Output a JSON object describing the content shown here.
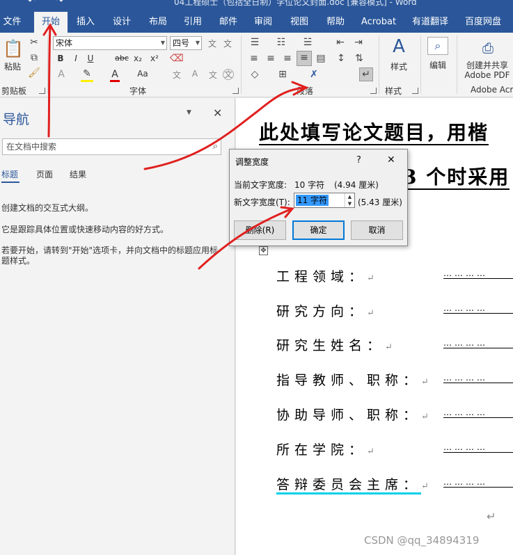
{
  "window": {
    "title": "04工程硕士（包括全日制）学位论文封面.doc [兼容模式] - Word"
  },
  "tabs": [
    "文件",
    "开始",
    "插入",
    "设计",
    "布局",
    "引用",
    "邮件",
    "审阅",
    "视图",
    "帮助",
    "Acrobat",
    "有道翻译",
    "百度网盘"
  ],
  "ribbon": {
    "clipboard": {
      "paste": "粘贴",
      "group": "剪贴板"
    },
    "font": {
      "name": "宋体",
      "size": "四号",
      "group": "字体",
      "bold": "B",
      "italic": "I",
      "underline": "U",
      "strike": "abc",
      "sub": "x₂",
      "sup": "x²",
      "grow": "Aa",
      "wen": "文",
      "char": "A"
    },
    "paragraph": {
      "group": "段落"
    },
    "styles": {
      "label": "样式",
      "group": "样式"
    },
    "editing": {
      "label": "编辑"
    },
    "adobe": {
      "line1": "创建并共享",
      "line2": "Adobe PDF",
      "group": "Adobe Acr"
    }
  },
  "nav": {
    "title": "导航",
    "search_placeholder": "在文档中搜索",
    "tabs": [
      "标题",
      "页面",
      "结果"
    ],
    "msg1": "创建文档的交互式大纲。",
    "msg2": "它是跟踪具体位置或快速移动内容的好方式。",
    "msg3": "若要开始，请转到\"开始\"选项卡，并向文档中的标题应用标题样式。"
  },
  "dialog": {
    "title": "调整宽度",
    "help": "?",
    "close": "✕",
    "current_label": "当前文字宽度:",
    "current_value": "10 字符",
    "current_cm": "(4.94 厘米)",
    "new_label": "新文字宽度(T):",
    "new_value": "11 字符",
    "new_cm": "(5.43 厘米)",
    "delete": "删除(R)",
    "ok": "确定",
    "cancel": "取消"
  },
  "doc": {
    "title1": "此处填写论文题目，用楷",
    "title2": "3 个时采用",
    "fields": [
      "工程领域：",
      "研究方向：",
      "研究生姓名：",
      "指导教师、职称：",
      "协助导师、职称：",
      "所在学院：",
      "答辩委员会主席："
    ],
    "dots": "…………"
  },
  "watermark": "CSDN @qq_34894319",
  "colors": {
    "accent": "#2b579a",
    "annotation": "#e0201f",
    "selection": "#3399ff"
  }
}
